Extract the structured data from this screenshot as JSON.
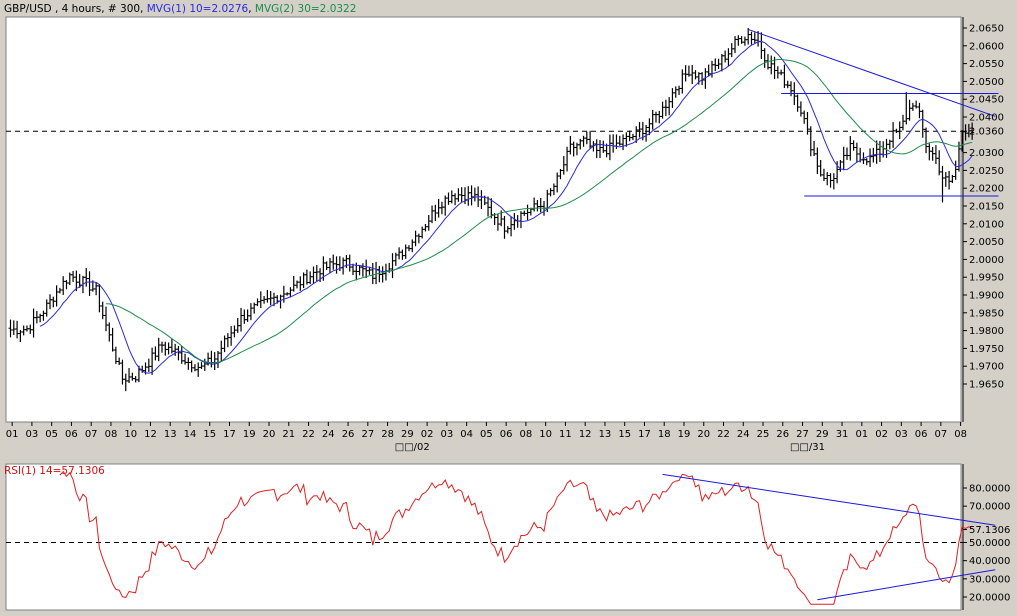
{
  "header": {
    "symbol_text": "GBP/USD , 4 hours, # 300, ",
    "ma1_text": "MVG(1) 10=2.0276",
    "ma_sep": ", ",
    "ma2_text": "MVG(2) 30=2.0322"
  },
  "rsi_header": {
    "text": "RSI(1) 14=57.1306"
  },
  "colors": {
    "background": "#d4d0c8",
    "panel": "#ffffff",
    "bars": "#000000",
    "ma1": "#2a2ae0",
    "ma2": "#1e8c4a",
    "trendline": "#1a1adc",
    "rsi": "#e02020"
  },
  "chart_data": [
    {
      "type": "ohlc",
      "y_axis_position": "right",
      "ylim": [
        1.9625,
        2.066
      ],
      "y_ticks": [
        "2.0650",
        "2.0600",
        "2.0550",
        "2.0500",
        "2.0450",
        "2.0400",
        "2.0360",
        "2.0300",
        "2.0250",
        "2.0200",
        "2.0150",
        "2.0100",
        "2.0050",
        "2.0000",
        "1.9950",
        "1.9900",
        "1.9850",
        "1.9800",
        "1.9750",
        "1.9700",
        "1.9650"
      ],
      "y_tick_values": [
        2.065,
        2.06,
        2.055,
        2.05,
        2.045,
        2.04,
        2.036,
        2.03,
        2.025,
        2.02,
        2.015,
        2.01,
        2.005,
        2.0,
        1.995,
        1.99,
        1.985,
        1.98,
        1.975,
        1.97,
        1.965
      ],
      "current_price": 2.036,
      "current_price_label": "2.0360",
      "x_ticks": [
        "01",
        "03",
        "05",
        "06",
        "07",
        "08",
        "10",
        "12",
        "13",
        "14",
        "15",
        "17",
        "19",
        "20",
        "21",
        "22",
        "24",
        "26",
        "27",
        "28",
        "29",
        "02",
        "03",
        "04",
        "05",
        "06",
        "08",
        "10",
        "11",
        "12",
        "13",
        "15",
        "17",
        "18",
        "19",
        "20",
        "22",
        "24",
        "25",
        "26",
        "27",
        "29",
        "31",
        "01",
        "02",
        "03",
        "06",
        "07",
        "08"
      ],
      "x_tick_pos": [
        0.5,
        6.5,
        12.5,
        18.5,
        24.5,
        30.5,
        36.5,
        42.5,
        48.5,
        54.5,
        60.5,
        66.5,
        72.5,
        78.5,
        84.5,
        90.5,
        96.5,
        102.5,
        108.5,
        114.5,
        120.5,
        126.5,
        132.5,
        138.5,
        144.5,
        150.5,
        156.5,
        162.5,
        168.5,
        174.5,
        180.5,
        186.5,
        192.5,
        198.5,
        204.5,
        210.5,
        216.5,
        222.5,
        228.5,
        234.5,
        240.5,
        246.5,
        252.5,
        258.5,
        264.5,
        270.5,
        276.5,
        282.5,
        288.5
      ],
      "month_labels": [
        "□□/02",
        "□□/31"
      ],
      "month_label_pos": [
        122,
        242
      ],
      "ma_periods": [
        10,
        30
      ],
      "ma_last_values": [
        2.0276,
        2.0322
      ],
      "price_anchors": [
        [
          0,
          1.9802
        ],
        [
          5,
          1.9805
        ],
        [
          10,
          1.9855
        ],
        [
          15,
          1.9922
        ],
        [
          18,
          1.9955
        ],
        [
          23,
          1.9932
        ],
        [
          26,
          1.9912
        ],
        [
          28,
          1.9845
        ],
        [
          31,
          1.9752
        ],
        [
          34,
          1.9665
        ],
        [
          38,
          1.9672
        ],
        [
          42,
          1.9712
        ],
        [
          46,
          1.976
        ],
        [
          50,
          1.974
        ],
        [
          54,
          1.9712
        ],
        [
          58,
          1.9695
        ],
        [
          62,
          1.9722
        ],
        [
          66,
          1.9782
        ],
        [
          70,
          1.9835
        ],
        [
          74,
          1.9862
        ],
        [
          78,
          1.9882
        ],
        [
          82,
          1.9902
        ],
        [
          86,
          1.9922
        ],
        [
          90,
          1.995
        ],
        [
          94,
          1.9972
        ],
        [
          98,
          1.9985
        ],
        [
          102,
          1.999
        ],
        [
          106,
          1.9972
        ],
        [
          110,
          1.9955
        ],
        [
          114,
          1.998
        ],
        [
          118,
          2.001
        ],
        [
          122,
          2.0055
        ],
        [
          126,
          2.01
        ],
        [
          130,
          2.0155
        ],
        [
          134,
          2.0182
        ],
        [
          138,
          2.0182
        ],
        [
          142,
          2.0172
        ],
        [
          146,
          2.0132
        ],
        [
          150,
          2.0092
        ],
        [
          154,
          2.0122
        ],
        [
          158,
          2.014
        ],
        [
          162,
          2.0155
        ],
        [
          166,
          2.0222
        ],
        [
          170,
          2.0312
        ],
        [
          174,
          2.0332
        ],
        [
          178,
          2.0302
        ],
        [
          182,
          2.0312
        ],
        [
          186,
          2.0332
        ],
        [
          190,
          2.0352
        ],
        [
          194,
          2.0382
        ],
        [
          198,
          2.0422
        ],
        [
          202,
          2.0482
        ],
        [
          206,
          2.0532
        ],
        [
          210,
          2.0512
        ],
        [
          214,
          2.0542
        ],
        [
          218,
          2.0582
        ],
        [
          221,
          2.0618
        ],
        [
          224,
          2.0632
        ],
        [
          227,
          2.0612
        ],
        [
          230,
          2.0552
        ],
        [
          234,
          2.0512
        ],
        [
          237,
          2.0482
        ],
        [
          240,
          2.0422
        ],
        [
          243,
          2.0322
        ],
        [
          246,
          2.0242
        ],
        [
          249,
          2.0222
        ],
        [
          252,
          2.0262
        ],
        [
          255,
          2.0312
        ],
        [
          258,
          2.0292
        ],
        [
          261,
          2.0282
        ],
        [
          264,
          2.0302
        ],
        [
          267,
          2.0342
        ],
        [
          270,
          2.0362
        ],
        [
          272,
          2.0402
        ],
        [
          274,
          2.0442
        ],
        [
          276,
          2.0402
        ],
        [
          278,
          2.0322
        ],
        [
          281,
          2.0282
        ],
        [
          283,
          2.0232
        ],
        [
          285,
          2.0212
        ],
        [
          287,
          2.0252
        ],
        [
          289,
          2.0362
        ],
        [
          291,
          2.0372
        ],
        [
          292,
          2.036
        ]
      ],
      "series": [
        {
          "name": "MVG(1) 10",
          "kind": "sma",
          "period": 10
        },
        {
          "name": "MVG(2) 30",
          "kind": "sma",
          "period": 30
        }
      ],
      "trendlines": [
        {
          "from": [
            224,
            2.0646
          ],
          "to": [
            299,
            2.0402
          ]
        },
        {
          "from": [
            234,
            2.0466
          ],
          "to": [
            300,
            2.0466
          ]
        },
        {
          "from": [
            241,
            2.0178
          ],
          "to": [
            300,
            2.0178
          ]
        }
      ]
    },
    {
      "type": "line",
      "title": "RSI(1) 14=57.1306",
      "y_axis_position": "right",
      "ylim": [
        16,
        92
      ],
      "y_ticks": [
        "80.0000",
        "70.0000",
        "57.1306",
        "50.0000",
        "40.0000",
        "30.0000",
        "20.0000"
      ],
      "y_tick_values": [
        80,
        70,
        57.1306,
        50,
        40,
        30,
        20
      ],
      "reference_line": 50,
      "last_value": 57.1306,
      "series": [
        {
          "name": "RSI(1) 14",
          "period": 14
        }
      ],
      "trendlines": [
        {
          "from": [
            198,
            87.5
          ],
          "to": [
            299,
            59.5
          ]
        },
        {
          "from": [
            245,
            18.5
          ],
          "to": [
            299,
            35.0
          ]
        }
      ]
    }
  ]
}
